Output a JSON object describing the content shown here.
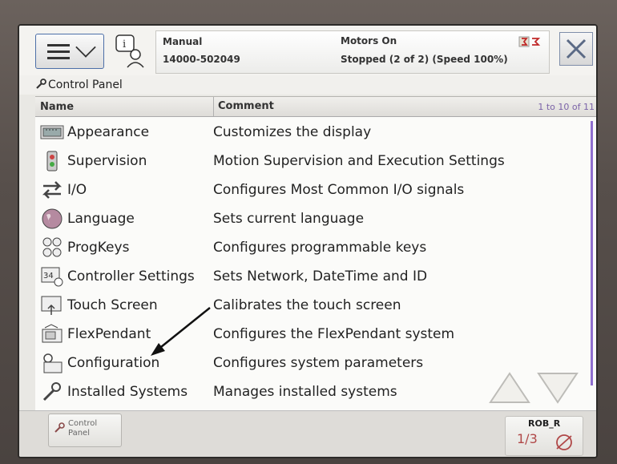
{
  "header": {
    "mode": "Manual",
    "system_name": "14000-502049",
    "motors": "Motors On",
    "state": "Stopped (2 of 2) (Speed 100%)"
  },
  "breadcrumb": "Control Panel",
  "table": {
    "col_name": "Name",
    "col_comment": "Comment",
    "count": "1 to 10 of 11",
    "rows": [
      {
        "name": "Appearance",
        "comment": "Customizes the display",
        "icon": "appearance-icon"
      },
      {
        "name": "Supervision",
        "comment": "Motion Supervision and Execution Settings",
        "icon": "supervision-icon"
      },
      {
        "name": "I/O",
        "comment": "Configures Most Common I/O signals",
        "icon": "io-icon"
      },
      {
        "name": "Language",
        "comment": "Sets current language",
        "icon": "language-icon"
      },
      {
        "name": "ProgKeys",
        "comment": "Configures programmable keys",
        "icon": "progkeys-icon"
      },
      {
        "name": "Controller Settings",
        "comment": "Sets Network, DateTime and ID",
        "icon": "controller-settings-icon"
      },
      {
        "name": "Touch Screen",
        "comment": "Calibrates the touch screen",
        "icon": "touch-screen-icon"
      },
      {
        "name": "FlexPendant",
        "comment": "Configures the FlexPendant system",
        "icon": "flexpendant-icon"
      },
      {
        "name": "Configuration",
        "comment": "Configures system parameters",
        "icon": "configuration-icon"
      },
      {
        "name": "Installed Systems",
        "comment": "Manages installed systems",
        "icon": "installed-systems-icon"
      }
    ]
  },
  "taskbar": {
    "control_panel_line1": "Control",
    "control_panel_line2": "Panel",
    "rob_name": "ROB_R",
    "rob_fraction": "1/3"
  }
}
